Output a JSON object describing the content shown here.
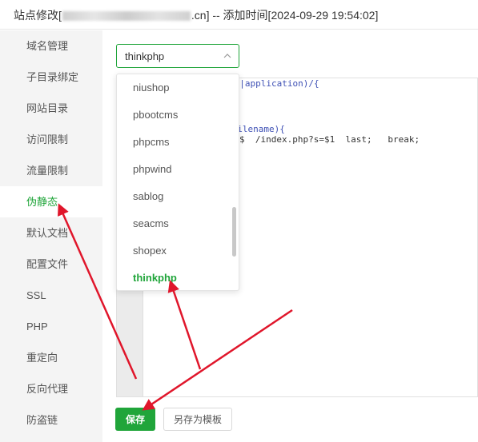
{
  "header": {
    "title_prefix": "站点修改[",
    "title_suffix": ".cn] -- 添加时间[2024-09-29 19:54:02]"
  },
  "sidebar": {
    "items": [
      {
        "label": "域名管理"
      },
      {
        "label": "子目录绑定"
      },
      {
        "label": "网站目录"
      },
      {
        "label": "访问限制"
      },
      {
        "label": "流量限制"
      },
      {
        "label": "伪静态",
        "active": true
      },
      {
        "label": "默认文档"
      },
      {
        "label": "配置文件"
      },
      {
        "label": "SSL"
      },
      {
        "label": "PHP"
      },
      {
        "label": "重定向"
      },
      {
        "label": "反向代理"
      },
      {
        "label": "防盗链"
      }
    ]
  },
  "rewrite": {
    "selected_template": "thinkphp",
    "dropdown_options": [
      "niushop",
      "pbootcms",
      "phpcms",
      "phpwind",
      "sablog",
      "seacms",
      "shopex",
      "thinkphp"
    ],
    "code_lines": {
      "line1_a": "me|application)/{",
      "line2_a": "_filename){",
      "line3_a": "$  /index.php?s=$1  last;   break;"
    }
  },
  "buttons": {
    "save_label": "保存",
    "save_as_template_label": "另存为模板"
  },
  "colors": {
    "accent": "#20a53a",
    "annotation_arrow": "#e0162b"
  }
}
